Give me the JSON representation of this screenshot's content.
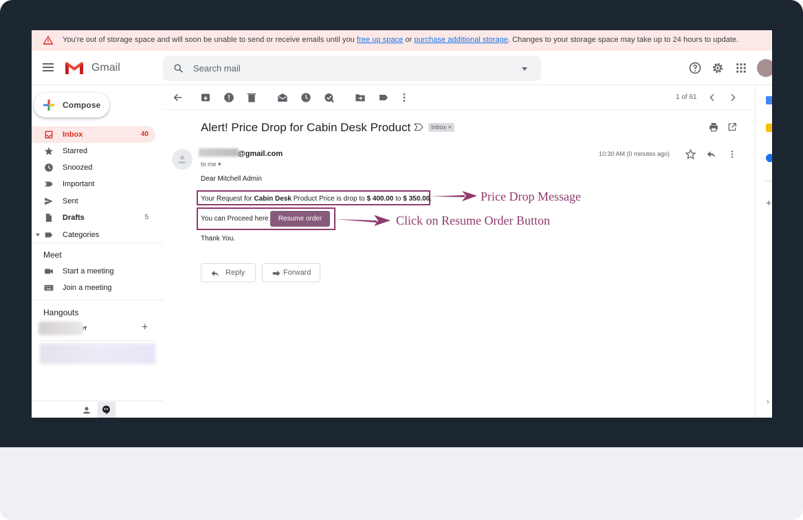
{
  "banner": {
    "prefix": "You're out of storage space and will soon be unable to send or receive emails until you",
    "link1": "free up space",
    "middle": "or",
    "link2": "purchase additional storage",
    "suffix": ". Changes to your storage space may take up to 24 hours to update."
  },
  "header": {
    "app_name": "Gmail",
    "search_placeholder": "Search mail",
    "icons": [
      "menu-icon",
      "help-icon",
      "settings-icon",
      "apps-grid-icon"
    ]
  },
  "compose_label": "Compose",
  "sidebar": {
    "items": [
      {
        "label": "Inbox",
        "count": "40",
        "icon": "inbox-icon"
      },
      {
        "label": "Starred",
        "count": "",
        "icon": "star-icon"
      },
      {
        "label": "Snoozed",
        "count": "",
        "icon": "clock-icon"
      },
      {
        "label": "Important",
        "count": "",
        "icon": "important-icon"
      },
      {
        "label": "Sent",
        "count": "",
        "icon": "send-icon"
      },
      {
        "label": "Drafts",
        "count": "5",
        "icon": "draft-icon"
      },
      {
        "label": "Categories",
        "count": "",
        "icon": "label-icon"
      }
    ],
    "meet_title": "Meet",
    "meet_items": [
      {
        "label": "Start a meeting",
        "icon": "video-icon"
      },
      {
        "label": "Join a meeting",
        "icon": "keyboard-icon"
      }
    ],
    "hangouts_title": "Hangouts",
    "hangouts_fragment": "n"
  },
  "toolbar": {
    "pager": "1 of 61"
  },
  "email": {
    "subject": "Alert! Price Drop for Cabin Desk Product",
    "tag": "Inbox",
    "sender": "@gmail.com",
    "to": "to me",
    "time": "10:30 AM (0 minutes ago)",
    "greeting": "Dear Mitchell Admin",
    "line1_a": "Your Request for",
    "line1_product": "Cabin Desk",
    "line1_b": "Product Price is drop to",
    "line1_old": "$ 400.00",
    "line1_to": "to",
    "line1_new": "$ 350.00",
    "line1_end": ".",
    "line2": "You can Proceed here",
    "resume_label": "Resume order",
    "thanks": "Thank You.",
    "reply_label": "Reply",
    "forward_label": "Forward"
  },
  "annotations": {
    "first": "Price Drop Message",
    "second": "Click on Resume Order Button"
  },
  "colors": {
    "annotation": "#8e3a6e",
    "resume_button": "#875a7b",
    "active_nav": "#d93025",
    "banner_bg": "#fce8e6"
  }
}
